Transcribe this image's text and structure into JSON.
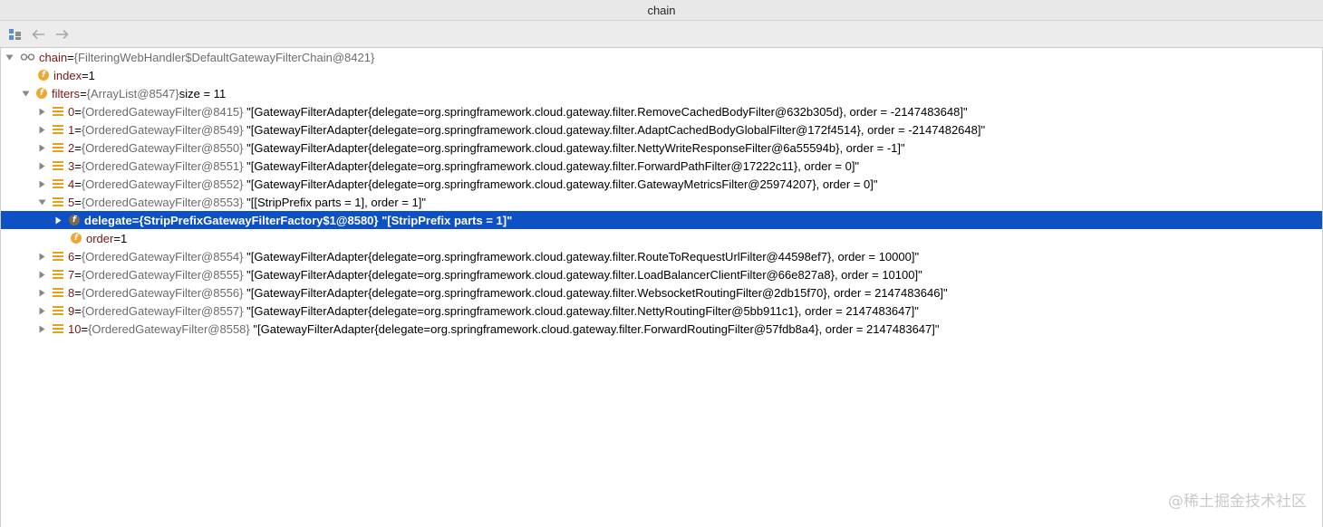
{
  "window": {
    "title": "chain"
  },
  "toolbar": {
    "buttons": [
      {
        "icon": "restore-layout-icon"
      },
      {
        "icon": "back-arrow-icon"
      },
      {
        "icon": "forward-arrow-icon"
      }
    ]
  },
  "tree": {
    "root": {
      "name": "chain",
      "eq": " = ",
      "type": "{FilteringWebHandler$DefaultGatewayFilterChain@8421}"
    },
    "index": {
      "name": "index",
      "eq": " = ",
      "value": "1"
    },
    "filters": {
      "name": "filters",
      "eq": " = ",
      "type": "{ArrayList@8547}",
      "size": "  size = 11"
    },
    "items": [
      {
        "name": "0",
        "type": "{OrderedGatewayFilter@8415}",
        "value": "\"[GatewayFilterAdapter{delegate=org.springframework.cloud.gateway.filter.RemoveCachedBodyFilter@632b305d}, order = -2147483648]\""
      },
      {
        "name": "1",
        "type": "{OrderedGatewayFilter@8549}",
        "value": "\"[GatewayFilterAdapter{delegate=org.springframework.cloud.gateway.filter.AdaptCachedBodyGlobalFilter@172f4514}, order = -2147482648]\""
      },
      {
        "name": "2",
        "type": "{OrderedGatewayFilter@8550}",
        "value": "\"[GatewayFilterAdapter{delegate=org.springframework.cloud.gateway.filter.NettyWriteResponseFilter@6a55594b}, order = -1]\""
      },
      {
        "name": "3",
        "type": "{OrderedGatewayFilter@8551}",
        "value": "\"[GatewayFilterAdapter{delegate=org.springframework.cloud.gateway.filter.ForwardPathFilter@17222c11}, order = 0]\""
      },
      {
        "name": "4",
        "type": "{OrderedGatewayFilter@8552}",
        "value": "\"[GatewayFilterAdapter{delegate=org.springframework.cloud.gateway.filter.GatewayMetricsFilter@25974207}, order = 0]\""
      },
      {
        "name": "5",
        "type": "{OrderedGatewayFilter@8553}",
        "value": "\"[[StripPrefix parts = 1], order = 1]\""
      }
    ],
    "item5_children": {
      "delegate": {
        "name": "delegate",
        "eq": " = ",
        "type": "{StripPrefixGatewayFilterFactory$1@8580}",
        "value": "\"[StripPrefix parts = 1]\""
      },
      "order": {
        "name": "order",
        "eq": " = ",
        "value": "1"
      }
    },
    "items_after": [
      {
        "name": "6",
        "type": "{OrderedGatewayFilter@8554}",
        "value": "\"[GatewayFilterAdapter{delegate=org.springframework.cloud.gateway.filter.RouteToRequestUrlFilter@44598ef7}, order = 10000]\""
      },
      {
        "name": "7",
        "type": "{OrderedGatewayFilter@8555}",
        "value": "\"[GatewayFilterAdapter{delegate=org.springframework.cloud.gateway.filter.LoadBalancerClientFilter@66e827a8}, order = 10100]\""
      },
      {
        "name": "8",
        "type": "{OrderedGatewayFilter@8556}",
        "value": "\"[GatewayFilterAdapter{delegate=org.springframework.cloud.gateway.filter.WebsocketRoutingFilter@2db15f70}, order = 2147483646]\""
      },
      {
        "name": "9",
        "type": "{OrderedGatewayFilter@8557}",
        "value": "\"[GatewayFilterAdapter{delegate=org.springframework.cloud.gateway.filter.NettyRoutingFilter@5bb911c1}, order = 2147483647]\""
      },
      {
        "name": "10",
        "type": "{OrderedGatewayFilter@8558}",
        "value": "\"[GatewayFilterAdapter{delegate=org.springframework.cloud.gateway.filter.ForwardRoutingFilter@57fdb8a4}, order = 2147483647]\""
      }
    ],
    "eq": " = "
  },
  "watermark": "@稀土掘金技术社区",
  "colors": {
    "selection": "#0d51c4",
    "field_name": "#7a1616",
    "field_icon": "#f0a732"
  }
}
